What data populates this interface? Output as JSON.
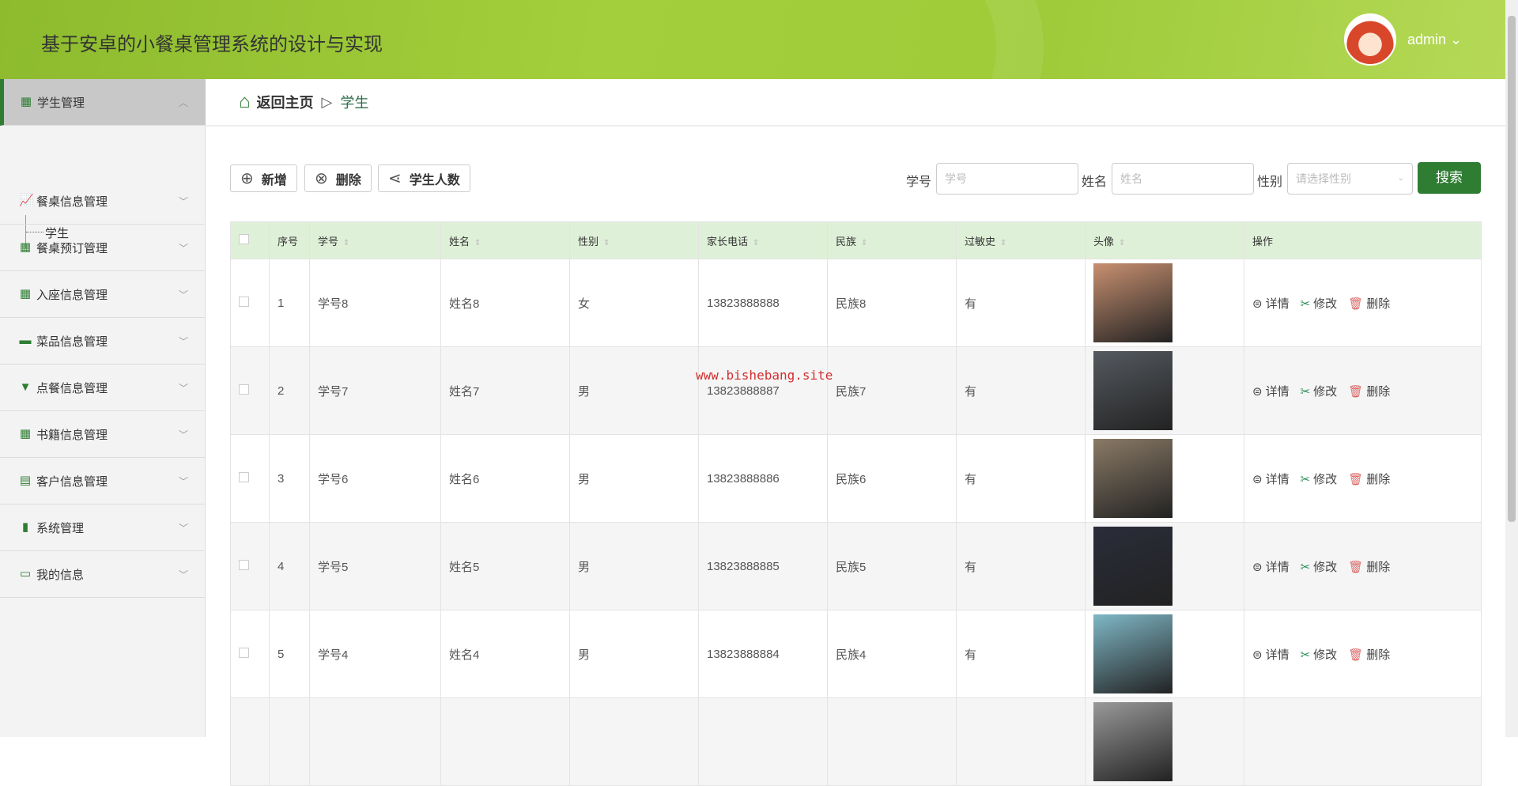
{
  "header": {
    "title": "基于安卓的小餐桌管理系统的设计与实现",
    "user": "admin"
  },
  "sidebar": {
    "items": [
      {
        "label": "学生管理",
        "icon": "grid-icon"
      },
      {
        "label": "餐桌信息管理",
        "icon": "chart-icon"
      },
      {
        "label": "餐桌预订管理",
        "icon": "grid-icon"
      },
      {
        "label": "入座信息管理",
        "icon": "grid-icon"
      },
      {
        "label": "菜品信息管理",
        "icon": "briefcase-icon"
      },
      {
        "label": "点餐信息管理",
        "icon": "brush-icon"
      },
      {
        "label": "书籍信息管理",
        "icon": "grid-icon"
      },
      {
        "label": "客户信息管理",
        "icon": "clipboard-icon"
      },
      {
        "label": "系统管理",
        "icon": "bar-chart-icon"
      },
      {
        "label": "我的信息",
        "icon": "card-icon"
      }
    ],
    "sub": "学生"
  },
  "breadcrumb": {
    "home": "返回主页",
    "current": "学生"
  },
  "toolbar": {
    "add": "新增",
    "delete": "删除",
    "count": "学生人数"
  },
  "search": {
    "id_label": "学号",
    "id_placeholder": "学号",
    "name_label": "姓名",
    "name_placeholder": "姓名",
    "gender_label": "性别",
    "gender_placeholder": "请选择性别",
    "button": "搜索"
  },
  "table": {
    "headers": [
      "序号",
      "学号",
      "姓名",
      "性别",
      "家长电话",
      "民族",
      "过敏史",
      "头像",
      "操作"
    ],
    "rows": [
      {
        "no": "1",
        "id": "学号8",
        "name": "姓名8",
        "gender": "女",
        "phone": "13823888888",
        "nation": "民族8",
        "allergy": "有",
        "color": "#c89070"
      },
      {
        "no": "2",
        "id": "学号7",
        "name": "姓名7",
        "gender": "男",
        "phone": "13823888887",
        "nation": "民族7",
        "allergy": "有",
        "color": "#555a60"
      },
      {
        "no": "3",
        "id": "学号6",
        "name": "姓名6",
        "gender": "男",
        "phone": "13823888886",
        "nation": "民族6",
        "allergy": "有",
        "color": "#8a7a66"
      },
      {
        "no": "4",
        "id": "学号5",
        "name": "姓名5",
        "gender": "男",
        "phone": "13823888885",
        "nation": "民族5",
        "allergy": "有",
        "color": "#2a2d3a"
      },
      {
        "no": "5",
        "id": "学号4",
        "name": "姓名4",
        "gender": "男",
        "phone": "13823888884",
        "nation": "民族4",
        "allergy": "有",
        "color": "#7fb7c6"
      },
      {
        "no": "",
        "id": "",
        "name": "",
        "gender": "",
        "phone": "",
        "nation": "",
        "allergy": "",
        "color": "#999"
      }
    ],
    "actions": {
      "detail": "详情",
      "edit": "修改",
      "delete": "删除"
    }
  },
  "watermark": "www.bishebang.site"
}
